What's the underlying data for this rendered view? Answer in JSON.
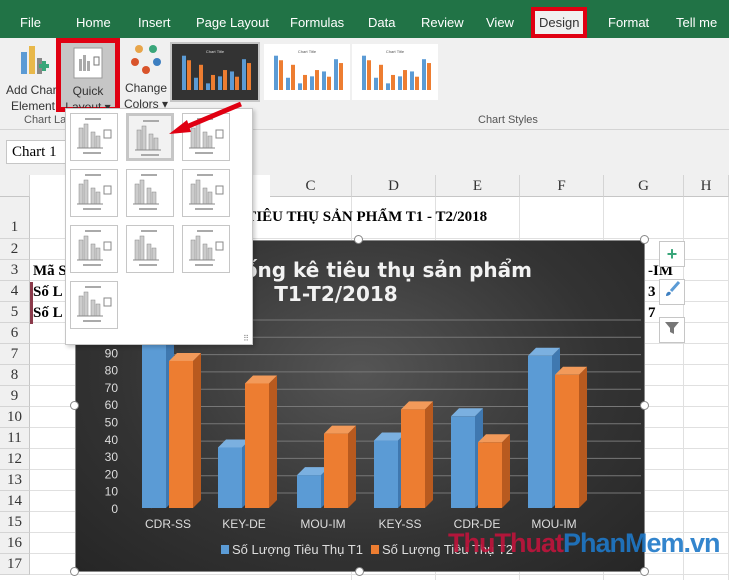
{
  "tabs": [
    "File",
    "Home",
    "Insert",
    "Page Layout",
    "Formulas",
    "Data",
    "Review",
    "View",
    "Design",
    "Format",
    "Tell me"
  ],
  "active_tab": "Design",
  "ribbon": {
    "add_chart_element": [
      "Add Chart",
      "Element"
    ],
    "quick_layout": [
      "Quick",
      "Layout"
    ],
    "change_colors": [
      "Change",
      "Colors"
    ],
    "group_chart_layouts": "Chart Layouts",
    "group_chart_styles": "Chart Styles",
    "style_thumb_title": "Chart Title"
  },
  "name_box": "Chart 1",
  "columns": [
    "C",
    "D",
    "E",
    "F",
    "G",
    "H"
  ],
  "rows": [
    "1",
    "2",
    "3",
    "4",
    "5",
    "6",
    "7",
    "8",
    "9",
    "10",
    "11",
    "12",
    "13",
    "14",
    "15",
    "16",
    "17"
  ],
  "cells": {
    "title": "C TIÊU THỤ SẢN PHẨM T1 - T2/2018",
    "a3": "Mã S",
    "a4": "Số L",
    "a5": "Số L",
    "g3": "-IM",
    "g4": "3",
    "g5": "7"
  },
  "colors": {
    "excel_green": "#217346",
    "highlight_red": "#e00012",
    "series1": "#5b9bd5",
    "series2": "#ed7d31"
  },
  "chart_data": {
    "type": "bar",
    "title": "thống kê tiêu thụ sản phẩm T1-T2/2018",
    "title_lines": [
      "thống kê tiêu thụ sản phẩm",
      "T1-T2/2018"
    ],
    "categories": [
      "CDR-SS",
      "KEY-DE",
      "MOU-IM",
      "KEY-SS",
      "CDR-DE",
      "MOU-IM"
    ],
    "series": [
      {
        "name": "Số Lượng Tiêu Thụ T1",
        "values": [
          98,
          35,
          19,
          39,
          53,
          88
        ]
      },
      {
        "name": "Số Lượng Tiêu Thụ T2",
        "values": [
          85,
          72,
          43,
          57,
          38,
          77
        ]
      }
    ],
    "yticks": [
      "0",
      "10",
      "20",
      "30",
      "40",
      "50",
      "60",
      "70",
      "80",
      "90"
    ],
    "ylim": [
      0,
      100
    ],
    "grid": true,
    "legend": "bottom",
    "style": "3d-column"
  },
  "watermark": "ThuThuatPhanMem.vn"
}
